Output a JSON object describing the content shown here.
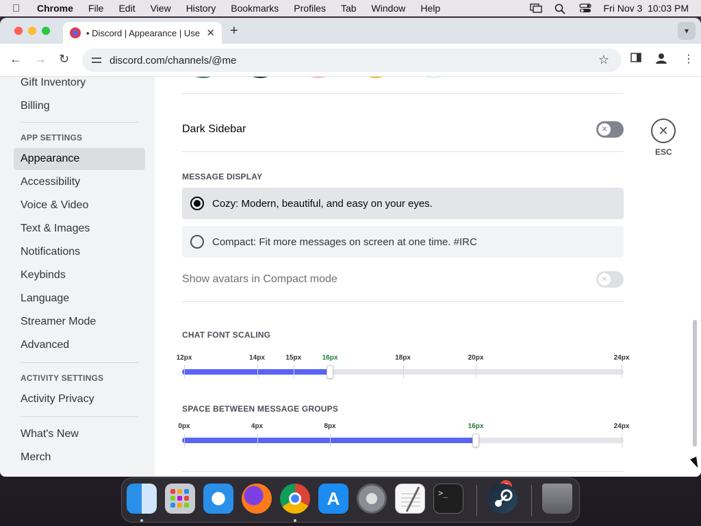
{
  "menubar": {
    "app": "Chrome",
    "items": [
      "File",
      "Edit",
      "View",
      "History",
      "Bookmarks",
      "Profiles",
      "Tab",
      "Window",
      "Help"
    ],
    "datetime": "Fri Nov 3  10:03 PM"
  },
  "browser": {
    "tab_title": "• Discord | Appearance | Use",
    "url": "discord.com/channels/@me"
  },
  "sidebar": {
    "items_top": [
      {
        "label": "Gift Inventory"
      },
      {
        "label": "Billing"
      }
    ],
    "app_settings_header": "APP SETTINGS",
    "app_settings": [
      {
        "label": "Appearance",
        "active": true
      },
      {
        "label": "Accessibility"
      },
      {
        "label": "Voice & Video"
      },
      {
        "label": "Text & Images"
      },
      {
        "label": "Notifications"
      },
      {
        "label": "Keybinds"
      },
      {
        "label": "Language"
      },
      {
        "label": "Streamer Mode"
      },
      {
        "label": "Advanced"
      }
    ],
    "activity_header": "ACTIVITY SETTINGS",
    "activity": [
      {
        "label": "Activity Privacy"
      }
    ],
    "bottom": [
      {
        "label": "What's New"
      },
      {
        "label": "Merch"
      }
    ]
  },
  "main": {
    "dark_sidebar": {
      "label": "Dark Sidebar",
      "enabled": false
    },
    "message_display": {
      "title": "MESSAGE DISPLAY",
      "options": [
        {
          "label": "Cozy: Modern, beautiful, and easy on your eyes.",
          "selected": true
        },
        {
          "label": "Compact: Fit more messages on screen at one time. #IRC",
          "selected": false
        }
      ],
      "show_avatars": {
        "label": "Show avatars in Compact mode",
        "enabled": false,
        "disabled": true
      }
    },
    "chat_font_scaling": {
      "title": "CHAT FONT SCALING",
      "min": 12,
      "max": 24,
      "value": 16,
      "markers": [
        "12px",
        "14px",
        "15px",
        "16px",
        "18px",
        "20px",
        "24px"
      ],
      "marker_values": [
        12,
        14,
        15,
        16,
        18,
        20,
        24
      ],
      "current_marker": "16px"
    },
    "space_between_groups": {
      "title": "SPACE BETWEEN MESSAGE GROUPS",
      "min": 0,
      "max": 24,
      "value": 16,
      "markers": [
        "0px",
        "4px",
        "8px",
        "16px",
        "24px"
      ],
      "marker_values": [
        0,
        4,
        8,
        16,
        24
      ],
      "current_marker": "16px"
    },
    "close": {
      "label": "ESC"
    }
  },
  "dock": {
    "items": [
      "finder-icon",
      "launchpad-icon",
      "safari-icon",
      "firefox-icon",
      "chrome-icon",
      "app-store-icon",
      "system-settings-icon",
      "textedit-icon",
      "terminal-icon",
      "steam-icon",
      "trash-icon"
    ],
    "settings_badge": "2"
  }
}
